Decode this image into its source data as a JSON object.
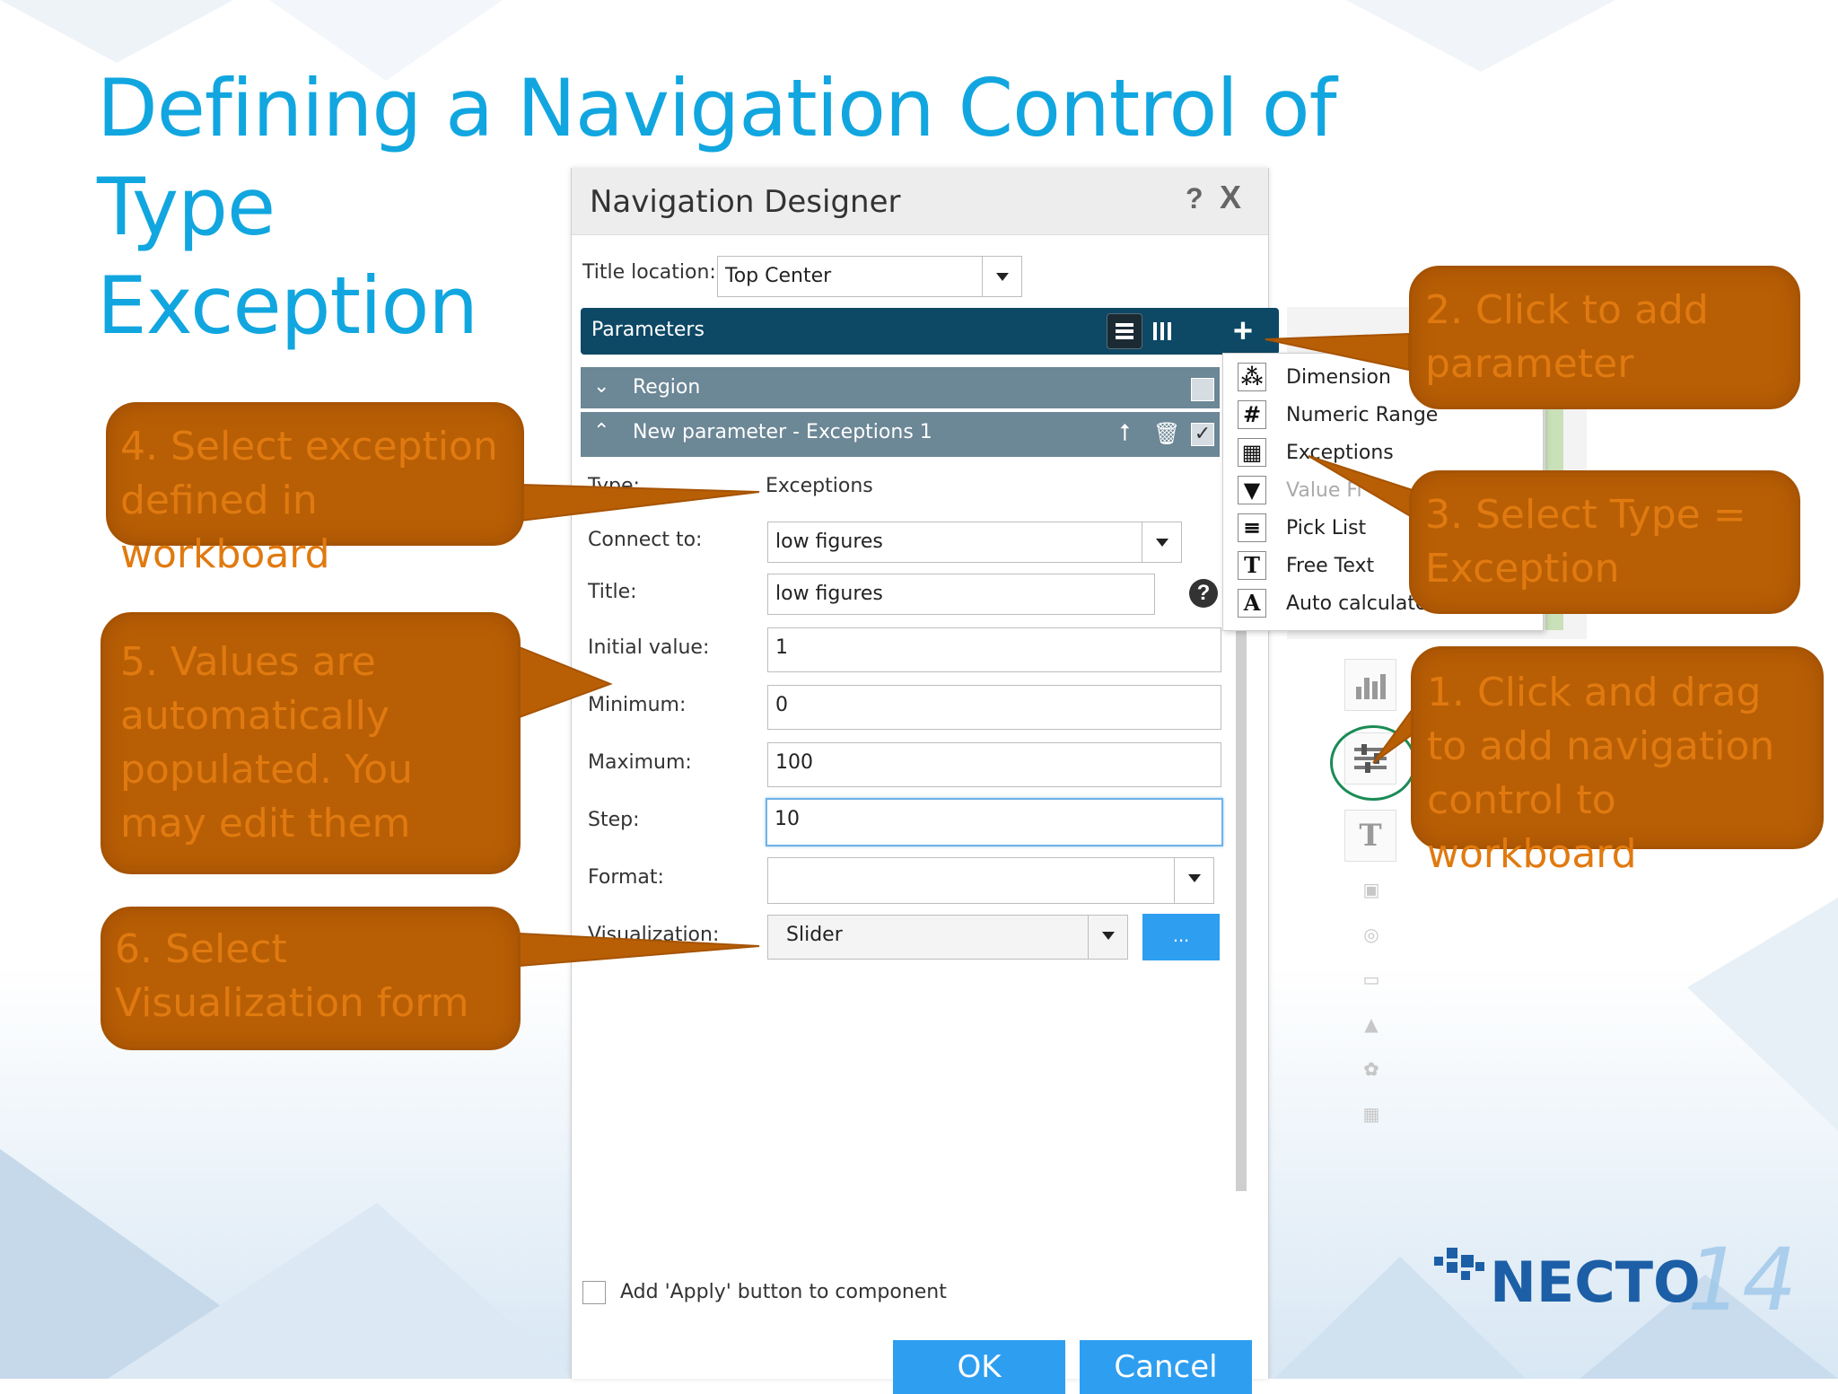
{
  "slide": {
    "title_line1": "Defining a Navigation Control of Type",
    "title_line2": "Exception"
  },
  "dialog": {
    "title": "Navigation Designer",
    "help": "?",
    "close": "X",
    "title_location_label": "Title location:",
    "title_location_value": "Top Center",
    "parameters_label": "Parameters",
    "add_icon": "+",
    "region_label": "Region",
    "new_param_label": "New parameter - Exceptions 1",
    "type_label": "Type:",
    "type_value": "Exceptions",
    "connect_to_label": "Connect to:",
    "connect_to_value": "low figures",
    "title_label": "Title:",
    "title_value": "low figures",
    "initial_value_label": "Initial value:",
    "initial_value": "1",
    "minimum_label": "Minimum:",
    "minimum_value": "0",
    "maximum_label": "Maximum:",
    "maximum_value": "100",
    "step_label": "Step:",
    "step_value": "10",
    "format_label": "Format:",
    "format_value": "",
    "visualization_label": "Visualization:",
    "visualization_value": "Slider",
    "viz_more": "...",
    "apply_checkbox_label": "Add 'Apply' button to component",
    "ok_label": "OK",
    "cancel_label": "Cancel"
  },
  "menu": {
    "items": [
      {
        "icon": "⁂",
        "label": "Dimension",
        "disabled": false
      },
      {
        "icon": "#",
        "label": "Numeric Range",
        "disabled": false
      },
      {
        "icon": "▦",
        "label": "Exceptions",
        "disabled": false
      },
      {
        "icon": "▼",
        "label": "Value Fi",
        "disabled": true
      },
      {
        "icon": "≡",
        "label": "Pick List",
        "disabled": false
      },
      {
        "icon": "T",
        "label": "Free Text",
        "disabled": false
      },
      {
        "icon": "A",
        "label": "Auto calculate",
        "disabled": false
      }
    ]
  },
  "callouts": {
    "c1": "1. Click and drag to add navigation control to workboard",
    "c2": "2. Click to add parameter",
    "c3": "3. Select Type = Exception",
    "c4": "4. Select exception defined in workboard",
    "c5": "5. Values are automatically populated. You may edit them",
    "c6": "6. Select Visualization form"
  },
  "logo": {
    "text": "NECTO",
    "version": "14"
  },
  "colors": {
    "title": "#11a6df",
    "callout_fill": "#b85f05",
    "callout_text": "#e07a10",
    "parameters_bar": "#0d4865",
    "row_bar": "#6c8796",
    "button_blue": "#2e9ef0"
  },
  "icons": {
    "list_view": "list-icon",
    "column_view": "columns-icon",
    "upload": "arrow-up-icon",
    "delete": "trash-icon",
    "check": "checkbox-icon"
  }
}
